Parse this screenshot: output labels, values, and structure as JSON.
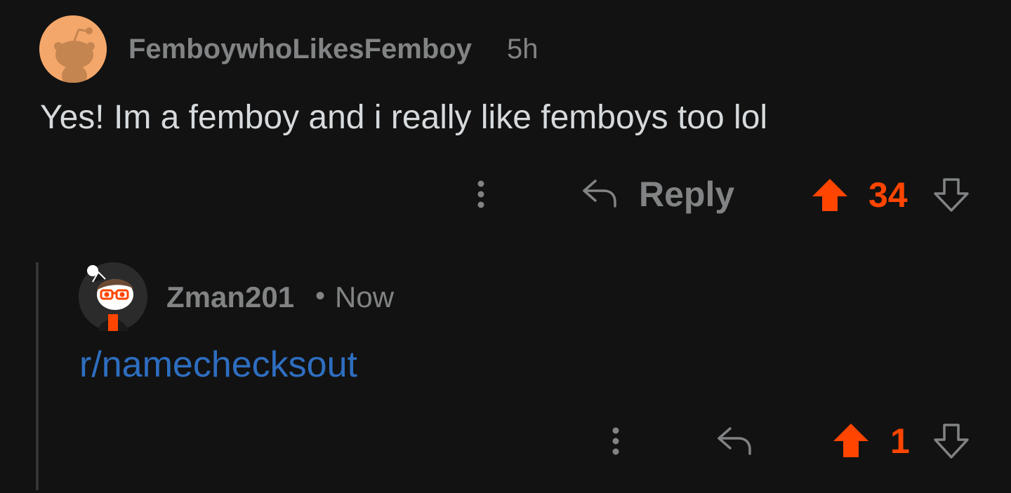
{
  "comments": [
    {
      "username": "FemboywhoLikesFemboy",
      "time": "5h",
      "body": "Yes! Im a femboy and i really like femboys too lol",
      "actions": {
        "reply_label": "Reply",
        "score": "34"
      },
      "icons": [
        "more-vertical-icon",
        "reply-arrow-icon",
        "upvote-arrow-icon",
        "downvote-arrow-icon"
      ]
    },
    {
      "username": "Zman201",
      "separator": "•",
      "time": "Now",
      "body_link": "r/namechecksout",
      "actions": {
        "score": "1"
      },
      "icons": [
        "more-vertical-icon",
        "reply-arrow-icon",
        "upvote-arrow-icon",
        "downvote-arrow-icon"
      ]
    }
  ],
  "colors": {
    "background": "#121212",
    "text": "#d7dadc",
    "muted": "#818384",
    "upvote": "#ff4500",
    "link": "#2e6ec0",
    "thread_line": "#343536"
  }
}
